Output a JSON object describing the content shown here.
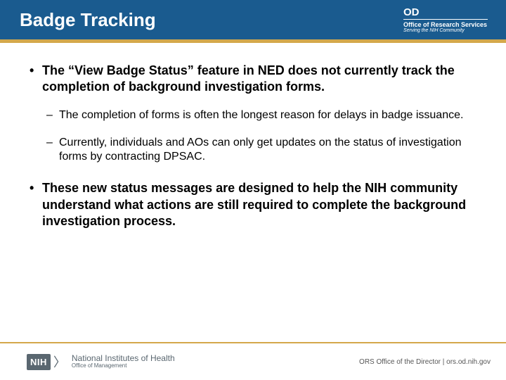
{
  "header": {
    "title": "Badge Tracking",
    "od": "OD",
    "od_sub1": "Office of Research Services",
    "od_sub2": "Serving the NIH Community"
  },
  "bullets": [
    {
      "text": "The “View Badge Status” feature in NED does not currently track the completion of background investigation forms.",
      "subs": [
        "The completion of forms is often the longest reason for delays in badge issuance.",
        "Currently, individuals and AOs can only get updates on the status of investigation forms by contracting DPSAC."
      ]
    },
    {
      "text": "These new status messages are designed to help the NIH community understand what actions are still required to complete the background investigation process.",
      "subs": []
    }
  ],
  "footer": {
    "nih_mark": "NIH",
    "nih_main": "National Institutes of Health",
    "nih_sub": "Office of Management",
    "right": "ORS Office of the Director | ors.od.nih.gov"
  }
}
